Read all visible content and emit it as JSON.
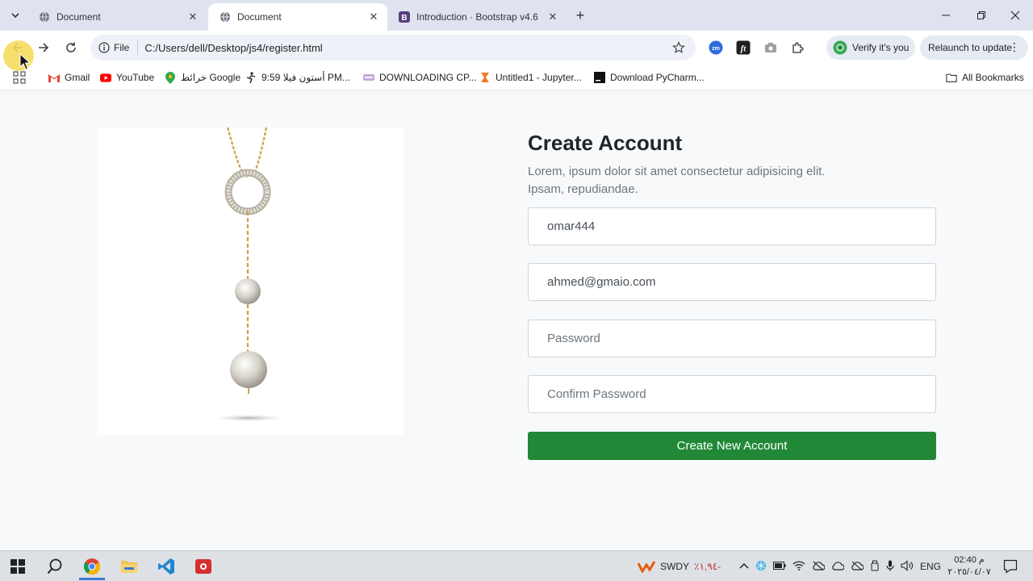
{
  "browser": {
    "tabs": [
      {
        "title": "Document",
        "active": false
      },
      {
        "title": "Document",
        "active": true
      },
      {
        "title": "Introduction · Bootstrap v4.6",
        "active": false
      }
    ],
    "address": {
      "scheme_label": "File",
      "url": "C:/Users/dell/Desktop/js4/register.html"
    },
    "verify_label": "Verify it's you",
    "relaunch_label": "Relaunch to update",
    "extension_zm_label": "zm",
    "bookmarks": [
      {
        "label": "Gmail",
        "icon": "gmail-icon"
      },
      {
        "label": "YouTube",
        "icon": "youtube-icon"
      },
      {
        "label": "خرائط Google",
        "icon": "maps-icon"
      },
      {
        "label": "أستون فيلا 9:59 PM...",
        "icon": "football-icon"
      },
      {
        "label": "DOWNLOADING CP...",
        "icon": "download-site-icon"
      },
      {
        "label": "Untitled1 - Jupyter...",
        "icon": "jupyter-icon"
      },
      {
        "label": "Download PyCharm...",
        "icon": "pycharm-icon"
      }
    ],
    "all_bookmarks_label": "All Bookmarks"
  },
  "page": {
    "form": {
      "title": "Create Account",
      "description": "Lorem, ipsum dolor sit amet consectetur adipisicing elit. Ipsam, repudiandae.",
      "username_value": "omar444",
      "email_value": "ahmed@gmaio.com",
      "password_placeholder": "Password",
      "confirm_placeholder": "Confirm Password",
      "submit_label": "Create New Account"
    },
    "image_alt_icon": "necklace-pendant-image"
  },
  "taskbar": {
    "weather_label": "SWDY",
    "weather_value": "٪١,٩٤-",
    "language": "ENG",
    "time": "02:40 م",
    "date": "٢٠٢٥/٠٤/٠٧"
  },
  "colors": {
    "accent_green": "#218838",
    "tab_strip": "#dfe3f0",
    "page_bg": "#f8f9fa"
  }
}
